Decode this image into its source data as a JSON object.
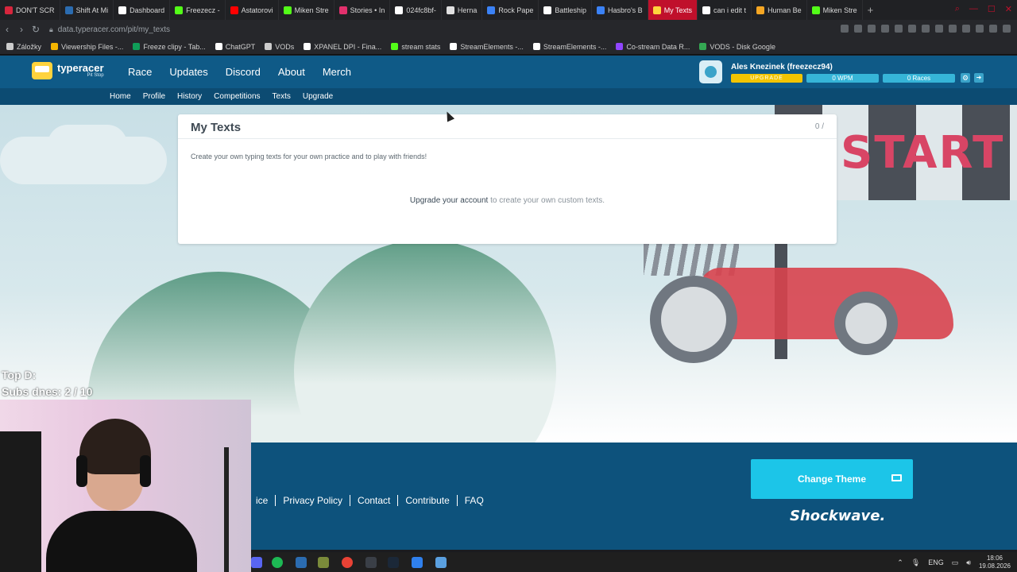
{
  "browser": {
    "tabs": [
      {
        "label": "DON'T SCR",
        "color": "#d7263d"
      },
      {
        "label": "Shift At Mi",
        "color": "#2b6cb0"
      },
      {
        "label": "Dashboard",
        "color": "#ffffff"
      },
      {
        "label": "Freezecz -",
        "color": "#53fc18"
      },
      {
        "label": "Astatorovi",
        "color": "#ff0000"
      },
      {
        "label": "Miken Stre",
        "color": "#53fc18"
      },
      {
        "label": "Stories • In",
        "color": "#e1306c"
      },
      {
        "label": "024fc8bf-",
        "color": "#ffffff"
      },
      {
        "label": "Herna",
        "color": "#e0e0e0"
      },
      {
        "label": "Rock Pape",
        "color": "#3b82f6"
      },
      {
        "label": "Battleship",
        "color": "#ffffff"
      },
      {
        "label": "Hasbro's B",
        "color": "#3b82f6"
      },
      {
        "label": "My Texts",
        "color": "#ffd33d",
        "active": true
      },
      {
        "label": "can i edit t",
        "color": "#ffffff"
      },
      {
        "label": "Human Be",
        "color": "#f5a623"
      },
      {
        "label": "Miken Stre",
        "color": "#53fc18"
      }
    ],
    "url_host": "data.typeracer.com",
    "url_path": "/pit/my_texts",
    "bookmarks": [
      {
        "label": "Záložky",
        "color": "#cccccc"
      },
      {
        "label": "Viewership Files -...",
        "color": "#f4b400"
      },
      {
        "label": "Freeze clipy - Tab...",
        "color": "#0f9d58"
      },
      {
        "label": "ChatGPT",
        "color": "#ffffff"
      },
      {
        "label": "VODs",
        "color": "#cccccc"
      },
      {
        "label": "XPANEL DPI - Fina...",
        "color": "#ffffff"
      },
      {
        "label": "stream stats",
        "color": "#53fc18"
      },
      {
        "label": "StreamElements -...",
        "color": "#ffffff"
      },
      {
        "label": "StreamElements -...",
        "color": "#ffffff"
      },
      {
        "label": "Co-stream Data R...",
        "color": "#9146ff"
      },
      {
        "label": "VODS - Disk Google",
        "color": "#34a853"
      }
    ]
  },
  "site": {
    "logo": {
      "name": "typeracer",
      "sub": "Pit Stop"
    },
    "main_nav": [
      "Race",
      "Updates",
      "Discord",
      "About",
      "Merch"
    ],
    "user": {
      "name": "Ales Knezinek (freezecz94)",
      "upgrade_label": "UPGRADE",
      "wpm": "0 WPM",
      "races": "0 Races"
    },
    "sub_nav": [
      "Home",
      "Profile",
      "History",
      "Competitions",
      "Texts",
      "Upgrade"
    ],
    "scene_text": "START",
    "panel": {
      "title": "My Texts",
      "count": "0 /",
      "description": "Create your own typing texts for your own practice and to play with friends!",
      "cta_link": "Upgrade your account",
      "cta_rest": " to create your own custom texts."
    },
    "footer": {
      "links": [
        "ice",
        "Privacy Policy",
        "Contact",
        "Contribute",
        "FAQ"
      ],
      "theme_button": "Change Theme",
      "brand": "Shockwave."
    }
  },
  "overlay": {
    "line1": "Top D:",
    "line2": "Subs dnes: 2 / 10"
  },
  "taskbar": {
    "lang": "ENG",
    "time": "18:06",
    "date": "19.08.2026"
  }
}
